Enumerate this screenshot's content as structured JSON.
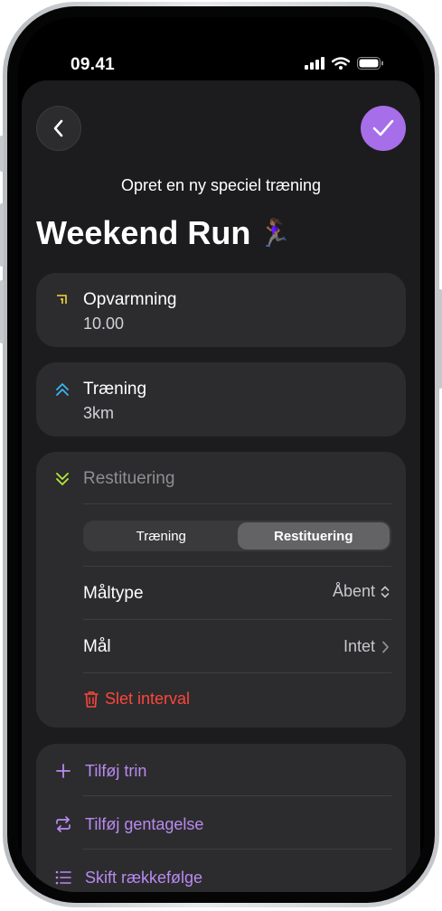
{
  "status_bar": {
    "time": "09.41"
  },
  "header": {
    "subtitle": "Opret en ny speciel træning",
    "title": "Weekend Run",
    "title_emoji": "🏃🏾‍♀️"
  },
  "steps": [
    {
      "name": "Opvarmning",
      "value": "10.00",
      "icon": "warmup-icon",
      "color": "#f2d63c"
    },
    {
      "name": "Træning",
      "value": "3km",
      "icon": "chevron-up-double-icon",
      "color": "#3ab7f0"
    },
    {
      "name": "Restituering",
      "icon": "chevron-down-double-icon",
      "color": "#b9e83a"
    }
  ],
  "editor": {
    "segments": [
      "Træning",
      "Restituering"
    ],
    "selected_segment": "Restituering",
    "goal_type_label": "Måltype",
    "goal_type_value": "Åbent",
    "goal_label": "Mål",
    "goal_value": "Intet",
    "delete_label": "Slet interval"
  },
  "actions": [
    {
      "label": "Tilføj trin",
      "icon": "plus-icon"
    },
    {
      "label": "Tilføj gentagelse",
      "icon": "repeat-icon"
    },
    {
      "label": "Skift rækkefølge",
      "icon": "list-icon"
    }
  ],
  "colors": {
    "accent": "#a66ee8",
    "action_text": "#b98af0",
    "delete": "#ff453a",
    "sheet": "#1c1c1e",
    "card": "#2c2c2e"
  }
}
